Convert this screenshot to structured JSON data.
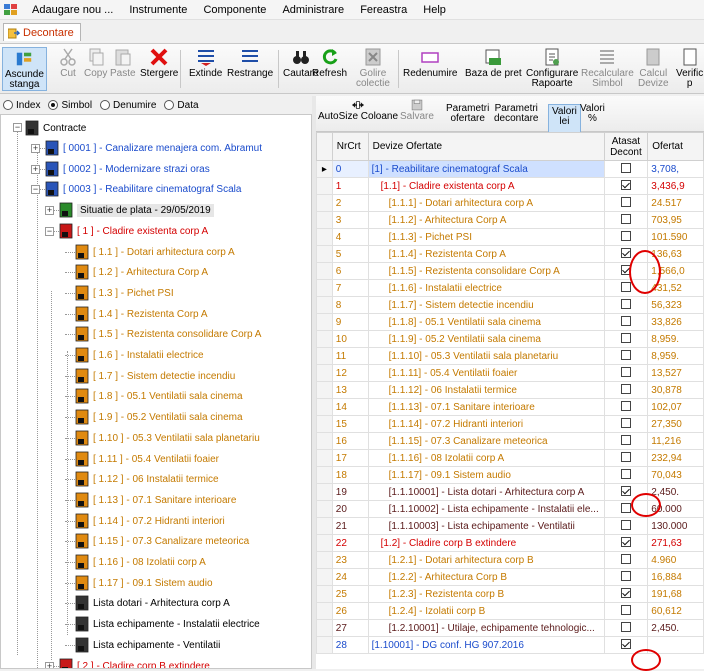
{
  "menu": [
    "Adaugare nou ...",
    "Instrumente",
    "Componente",
    "Administrare",
    "Fereastra",
    "Help"
  ],
  "tab": {
    "label": "Decontare"
  },
  "toolbar": [
    {
      "label": "Ascunde\nstanga",
      "icon": "hide-left-icon"
    },
    {
      "label": "Cut",
      "icon": "cut-icon"
    },
    {
      "label": "Copy",
      "icon": "copy-icon"
    },
    {
      "label": "Paste",
      "icon": "paste-icon"
    },
    {
      "label": "Stergere",
      "icon": "delete-icon"
    },
    {
      "label": "Extinde",
      "icon": "expand-icon"
    },
    {
      "label": "Restrange",
      "icon": "collapse-icon"
    },
    {
      "label": "Cautare",
      "icon": "binoculars-icon"
    },
    {
      "label": "Refresh",
      "icon": "refresh-icon"
    },
    {
      "label": "Golire\ncolectie",
      "icon": "clear-collection-icon"
    },
    {
      "label": "Redenumire",
      "icon": "rename-icon"
    },
    {
      "label": "Baza de pret",
      "icon": "price-base-icon"
    },
    {
      "label": "Configurare\nRapoarte",
      "icon": "configure-reports-icon"
    },
    {
      "label": "Recalculare\nSimbol",
      "icon": "recalculate-symbol-icon"
    },
    {
      "label": "Calcul\nDevize",
      "icon": "calc-estimates-icon"
    },
    {
      "label": "Verific\np",
      "icon": "verify-icon"
    }
  ],
  "radios": [
    {
      "label": "Index",
      "checked": false
    },
    {
      "label": "Simbol",
      "checked": true
    },
    {
      "label": "Denumire",
      "checked": false
    },
    {
      "label": "Data",
      "checked": false
    }
  ],
  "tree": {
    "root": "Contracte",
    "items": [
      {
        "text": "[ 0001 ] - Canalizare menajera com. Abramut",
        "color": "blue",
        "level": 1,
        "icon": "blue"
      },
      {
        "text": "[ 0002 ] - Modernizare strazi oras",
        "color": "blue",
        "level": 1,
        "icon": "blue"
      },
      {
        "text": "[ 0003 ] - Reabilitare cinematograf Scala",
        "color": "blue",
        "level": 1,
        "icon": "blue"
      },
      {
        "text": "Situatie de plata - 29/05/2019",
        "color": "black",
        "level": 2,
        "icon": "green",
        "selected": true
      },
      {
        "text": "[ 1 ] - Cladire existenta corp A",
        "color": "red",
        "level": 2,
        "icon": "red"
      },
      {
        "text": "[ 1.1 ] - Dotari arhitectura corp A",
        "color": "orange",
        "level": 3,
        "icon": "orange"
      },
      {
        "text": "[ 1.2 ] - Arhitectura Corp A",
        "color": "orange",
        "level": 3,
        "icon": "orange"
      },
      {
        "text": "[ 1.3 ] - Pichet PSI",
        "color": "orange",
        "level": 3,
        "icon": "orange"
      },
      {
        "text": "[ 1.4 ] - Rezistenta Corp A",
        "color": "orange",
        "level": 3,
        "icon": "orange"
      },
      {
        "text": "[ 1.5 ] - Rezistenta consolidare Corp A",
        "color": "orange",
        "level": 3,
        "icon": "orange"
      },
      {
        "text": "[ 1.6 ] - Instalatii electrice",
        "color": "orange",
        "level": 3,
        "icon": "orange"
      },
      {
        "text": "[ 1.7 ] - Sistem detectie incendiu",
        "color": "orange",
        "level": 3,
        "icon": "orange"
      },
      {
        "text": "[ 1.8 ] - 05.1 Ventilatii sala cinema",
        "color": "orange",
        "level": 3,
        "icon": "orange"
      },
      {
        "text": "[ 1.9 ] - 05.2 Ventilatii sala cinema",
        "color": "orange",
        "level": 3,
        "icon": "orange"
      },
      {
        "text": "[ 1.10 ] - 05.3 Ventilatii sala planetariu",
        "color": "orange",
        "level": 3,
        "icon": "orange"
      },
      {
        "text": "[ 1.11 ] - 05.4 Ventilatii foaier",
        "color": "orange",
        "level": 3,
        "icon": "orange"
      },
      {
        "text": "[ 1.12 ] - 06 Instalatii termice",
        "color": "orange",
        "level": 3,
        "icon": "orange"
      },
      {
        "text": "[ 1.13 ] - 07.1 Sanitare interioare",
        "color": "orange",
        "level": 3,
        "icon": "orange"
      },
      {
        "text": "[ 1.14 ] - 07.2 Hidranti interiori",
        "color": "orange",
        "level": 3,
        "icon": "orange"
      },
      {
        "text": "[ 1.15 ] - 07.3 Canalizare meteorica",
        "color": "orange",
        "level": 3,
        "icon": "orange"
      },
      {
        "text": "[ 1.16 ] - 08 Izolatii corp A",
        "color": "orange",
        "level": 3,
        "icon": "orange"
      },
      {
        "text": "[ 1.17 ] - 09.1 Sistem audio",
        "color": "orange",
        "level": 3,
        "icon": "orange"
      },
      {
        "text": "Lista dotari - Arhitectura corp A",
        "color": "black",
        "level": 3,
        "icon": "dark"
      },
      {
        "text": "Lista echipamente - Instalatii electrice",
        "color": "black",
        "level": 3,
        "icon": "dark"
      },
      {
        "text": "Lista echipamente - Ventilatii",
        "color": "black",
        "level": 3,
        "icon": "dark"
      },
      {
        "text": "[ 2 ] - Cladire corp B extindere",
        "color": "red",
        "level": 2,
        "icon": "red"
      }
    ]
  },
  "rtoolbar": [
    {
      "label": "AutoSize Coloane",
      "icon": "autosize-icon"
    },
    {
      "label": "Salvare",
      "icon": "save-icon"
    },
    {
      "label": "Parametri\nofertare",
      "icon": ""
    },
    {
      "label": "Parametri\ndecontare",
      "icon": ""
    },
    {
      "label": "Valori\nlei",
      "icon": ""
    },
    {
      "label": "Valori\n%",
      "icon": ""
    }
  ],
  "grid": {
    "headers": [
      "NrCrt",
      "Devize Ofertate",
      "Atasat\nDecont",
      "Ofertat"
    ],
    "rows": [
      {
        "nr": "0",
        "name": "[1] - Reabilitare cinematograf Scala",
        "checked": false,
        "val": "3,708,",
        "color": "blue",
        "current": true
      },
      {
        "nr": "1",
        "name": "[1.1] - Cladire existenta corp A",
        "checked": true,
        "val": "3,436,9",
        "color": "red"
      },
      {
        "nr": "2",
        "name": "[1.1.1] - Dotari arhitectura corp A",
        "checked": false,
        "val": "24.517",
        "color": "orange"
      },
      {
        "nr": "3",
        "name": "[1.1.2] - Arhitectura Corp A",
        "checked": false,
        "val": "703,95",
        "color": "orange"
      },
      {
        "nr": "4",
        "name": "[1.1.3] - Pichet PSI",
        "checked": false,
        "val": "101.590",
        "color": "orange"
      },
      {
        "nr": "5",
        "name": "[1.1.4] - Rezistenta Corp A",
        "checked": true,
        "val": "136,63",
        "color": "orange"
      },
      {
        "nr": "6",
        "name": "[1.1.5] - Rezistenta consolidare Corp A",
        "checked": true,
        "val": "1,566,0",
        "color": "orange"
      },
      {
        "nr": "7",
        "name": "[1.1.6] - Instalatii electrice",
        "checked": false,
        "val": "431,52",
        "color": "orange"
      },
      {
        "nr": "8",
        "name": "[1.1.7] - Sistem detectie incendiu",
        "checked": false,
        "val": "56,323",
        "color": "orange"
      },
      {
        "nr": "9",
        "name": "[1.1.8] - 05.1 Ventilatii sala cinema",
        "checked": false,
        "val": "33,826",
        "color": "orange"
      },
      {
        "nr": "10",
        "name": "[1.1.9] - 05.2 Ventilatii sala cinema",
        "checked": false,
        "val": "8,959.",
        "color": "orange"
      },
      {
        "nr": "11",
        "name": "[1.1.10] - 05.3 Ventilatii sala planetariu",
        "checked": false,
        "val": "8,959.",
        "color": "orange"
      },
      {
        "nr": "12",
        "name": "[1.1.11] - 05.4 Ventilatii foaier",
        "checked": false,
        "val": "13,527",
        "color": "orange"
      },
      {
        "nr": "13",
        "name": "[1.1.12] - 06 Instalatii termice",
        "checked": false,
        "val": "30,878",
        "color": "orange"
      },
      {
        "nr": "14",
        "name": "[1.1.13] - 07.1 Sanitare interioare",
        "checked": false,
        "val": "102,07",
        "color": "orange"
      },
      {
        "nr": "15",
        "name": "[1.1.14] - 07.2 Hidranti interiori",
        "checked": false,
        "val": "27,350",
        "color": "orange"
      },
      {
        "nr": "16",
        "name": "[1.1.15] - 07.3 Canalizare meteorica",
        "checked": false,
        "val": "11,216",
        "color": "orange"
      },
      {
        "nr": "17",
        "name": "[1.1.16] - 08 Izolatii corp A",
        "checked": false,
        "val": "232,94",
        "color": "orange"
      },
      {
        "nr": "18",
        "name": "[1.1.17] - 09.1 Sistem audio",
        "checked": false,
        "val": "70,043",
        "color": "orange"
      },
      {
        "nr": "19",
        "name": "[1.1.10001] - Lista dotari - Arhitectura corp A",
        "checked": true,
        "val": "2,450.",
        "color": "dark"
      },
      {
        "nr": "20",
        "name": "[1.1.10002] - Lista echipamente - Instalatii ele...",
        "checked": false,
        "val": "60.000",
        "color": "dark"
      },
      {
        "nr": "21",
        "name": "[1.1.10003] - Lista echipamente - Ventilatii",
        "checked": false,
        "val": "130.000",
        "color": "dark"
      },
      {
        "nr": "22",
        "name": "[1.2] - Cladire corp B extindere",
        "checked": true,
        "val": "271,63",
        "color": "red"
      },
      {
        "nr": "23",
        "name": "[1.2.1] - Dotari arhitectura corp B",
        "checked": false,
        "val": "4.960",
        "color": "orange"
      },
      {
        "nr": "24",
        "name": "[1.2.2] - Arhitectura Corp B",
        "checked": false,
        "val": "16,884",
        "color": "orange"
      },
      {
        "nr": "25",
        "name": "[1.2.3] - Rezistenta corp B",
        "checked": true,
        "val": "191,68",
        "color": "orange"
      },
      {
        "nr": "26",
        "name": "[1.2.4] - Izolatii corp B",
        "checked": false,
        "val": "60,612",
        "color": "orange"
      },
      {
        "nr": "27",
        "name": "[1.2.10001] - Utilaje, echipamente tehnologic...",
        "checked": false,
        "val": "2,450.",
        "color": "dark"
      },
      {
        "nr": "28",
        "name": "[1.10001] - DG conf. HG 907.2016",
        "checked": true,
        "val": "",
        "color": "blue"
      }
    ]
  }
}
